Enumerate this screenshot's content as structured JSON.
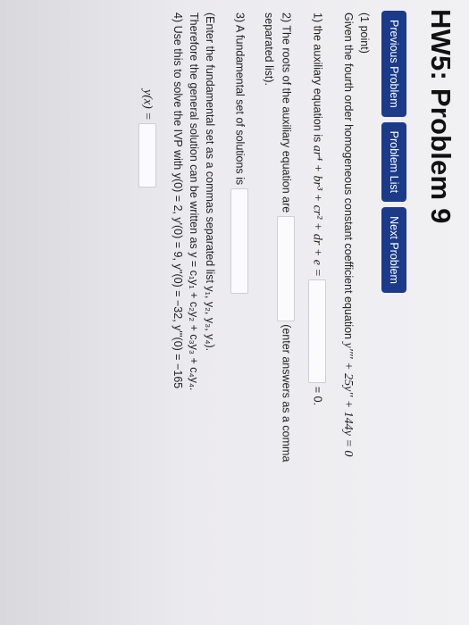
{
  "title": "HW5: Problem 9",
  "nav": {
    "previous": "Previous Problem",
    "list": "Problem List",
    "next": "Next Problem"
  },
  "problem": {
    "points": "(1 point)",
    "given_text": "Given the fourth order homogeneous constant coefficient equation",
    "equation": "y'''' + 25y'' + 144y = 0",
    "q1_prefix": "1) the auxiliary equation is",
    "q1_expr": "ar⁴ + br³ + cr² + dr + e =",
    "q1_suffix": "= 0.",
    "q2_prefix": "2) The roots of the auxiliary equation are",
    "q2_suffix": "(enter answers as a comma",
    "q2_cont": "separated list).",
    "q3": "3) A fundamental set of solutions is",
    "q3_note": "(Enter the fundamental set as a commas separated list y₁, y₂, y₃, y₄).",
    "general": "Therefore the general solution can be written as y = c₁y₁ + c₂y₂ + c₃y₃ + c₄y₄.",
    "q4": "4) Use this to solve the IVP with y(0) = 2,  y'(0) = 9,  y''(0) = −32,  y'''(0) = −165",
    "answer_label": "y(x) ="
  }
}
